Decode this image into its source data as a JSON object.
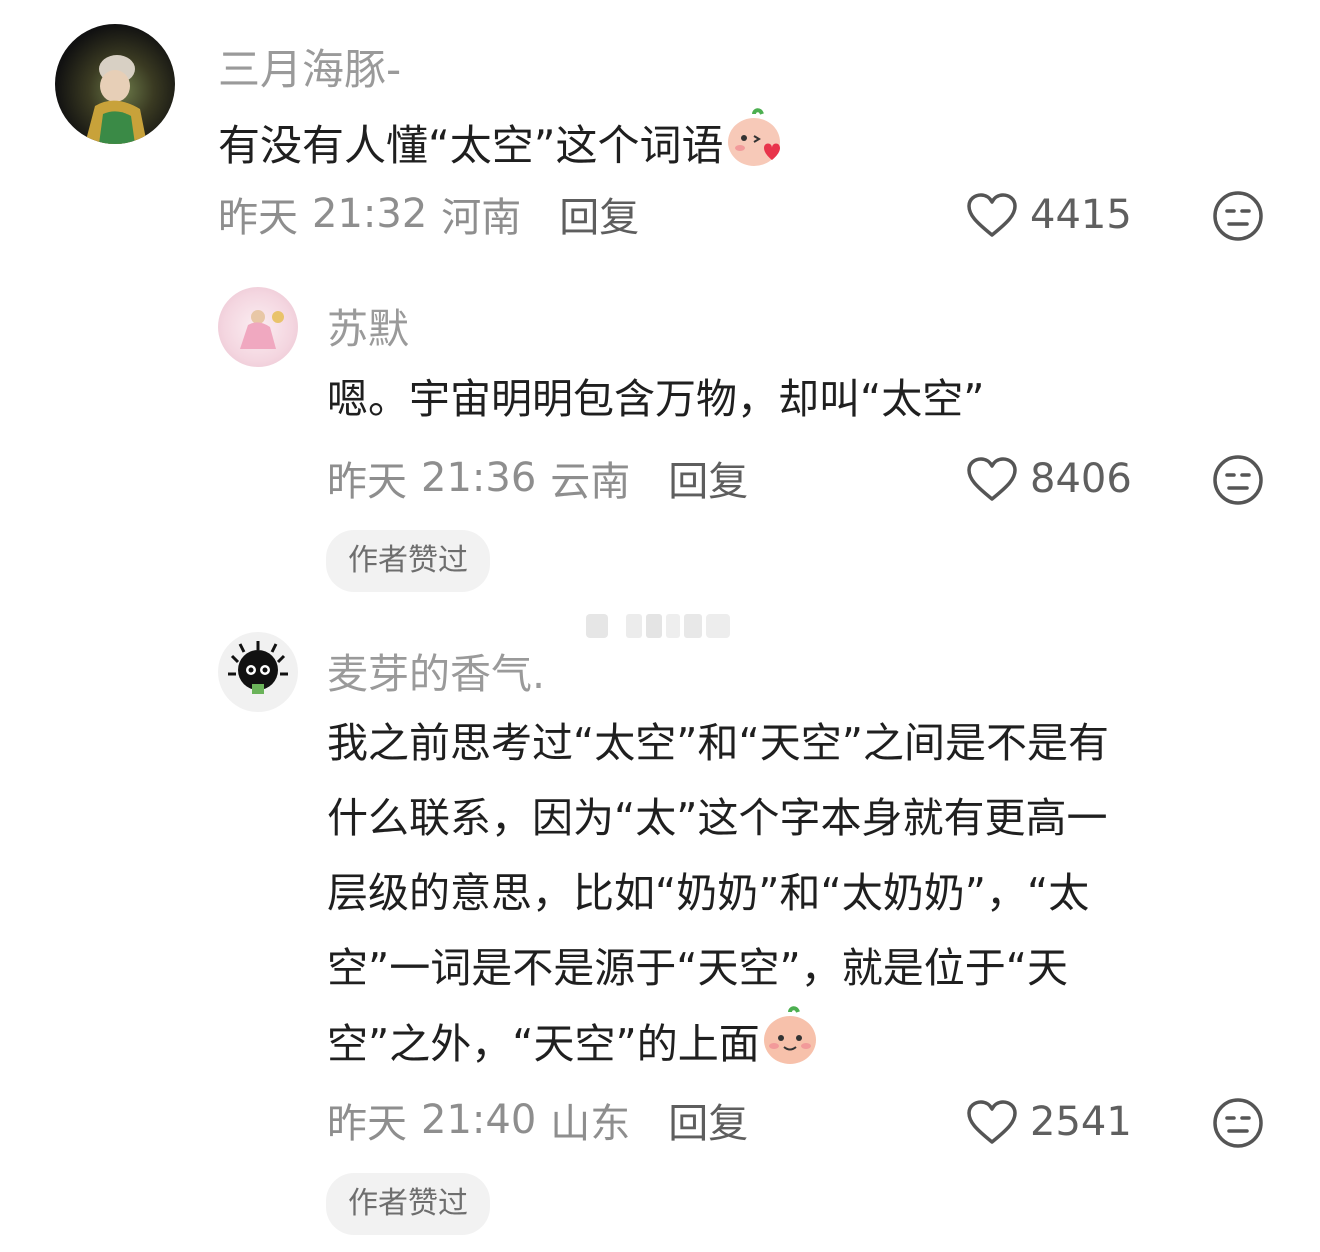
{
  "comments": [
    {
      "username": "三月海豚-",
      "text": "有没有人懂“太空”这个词语",
      "date": "昨天",
      "time": "21:32",
      "location": "河南",
      "reply_label": "回复",
      "likes": "4415",
      "emoji": "blushing-peach-emoji"
    },
    {
      "username": "苏默",
      "text": "嗯。宇宙明明包含万物，却叫“太空”",
      "date": "昨天",
      "time": "21:36",
      "location": "云南",
      "reply_label": "回复",
      "likes": "8406",
      "badge": "作者赞过"
    },
    {
      "username": "麦芽的香气.",
      "text_lines": [
        "我之前思考过“太空”和“天空”之间是不是有",
        "什么联系，因为“太”这个字本身就有更高一",
        "层级的意思，比如“奶奶”和“太奶奶”，“太",
        "空”一词是不是源于“天空”，就是位于“天",
        "空”之外，“天空”的上面"
      ],
      "date": "昨天",
      "time": "21:40",
      "location": "山东",
      "reply_label": "回复",
      "likes": "2541",
      "badge": "作者赞过",
      "emoji": "smiling-peach-emoji"
    }
  ],
  "icons": {
    "like": "heart-outline-icon",
    "dislike": "meh-face-icon"
  },
  "colors": {
    "text": "#1f1f1f",
    "username": "#9a9a9a",
    "meta": "#8e8e8e",
    "badge_bg": "#f2f2f2"
  }
}
